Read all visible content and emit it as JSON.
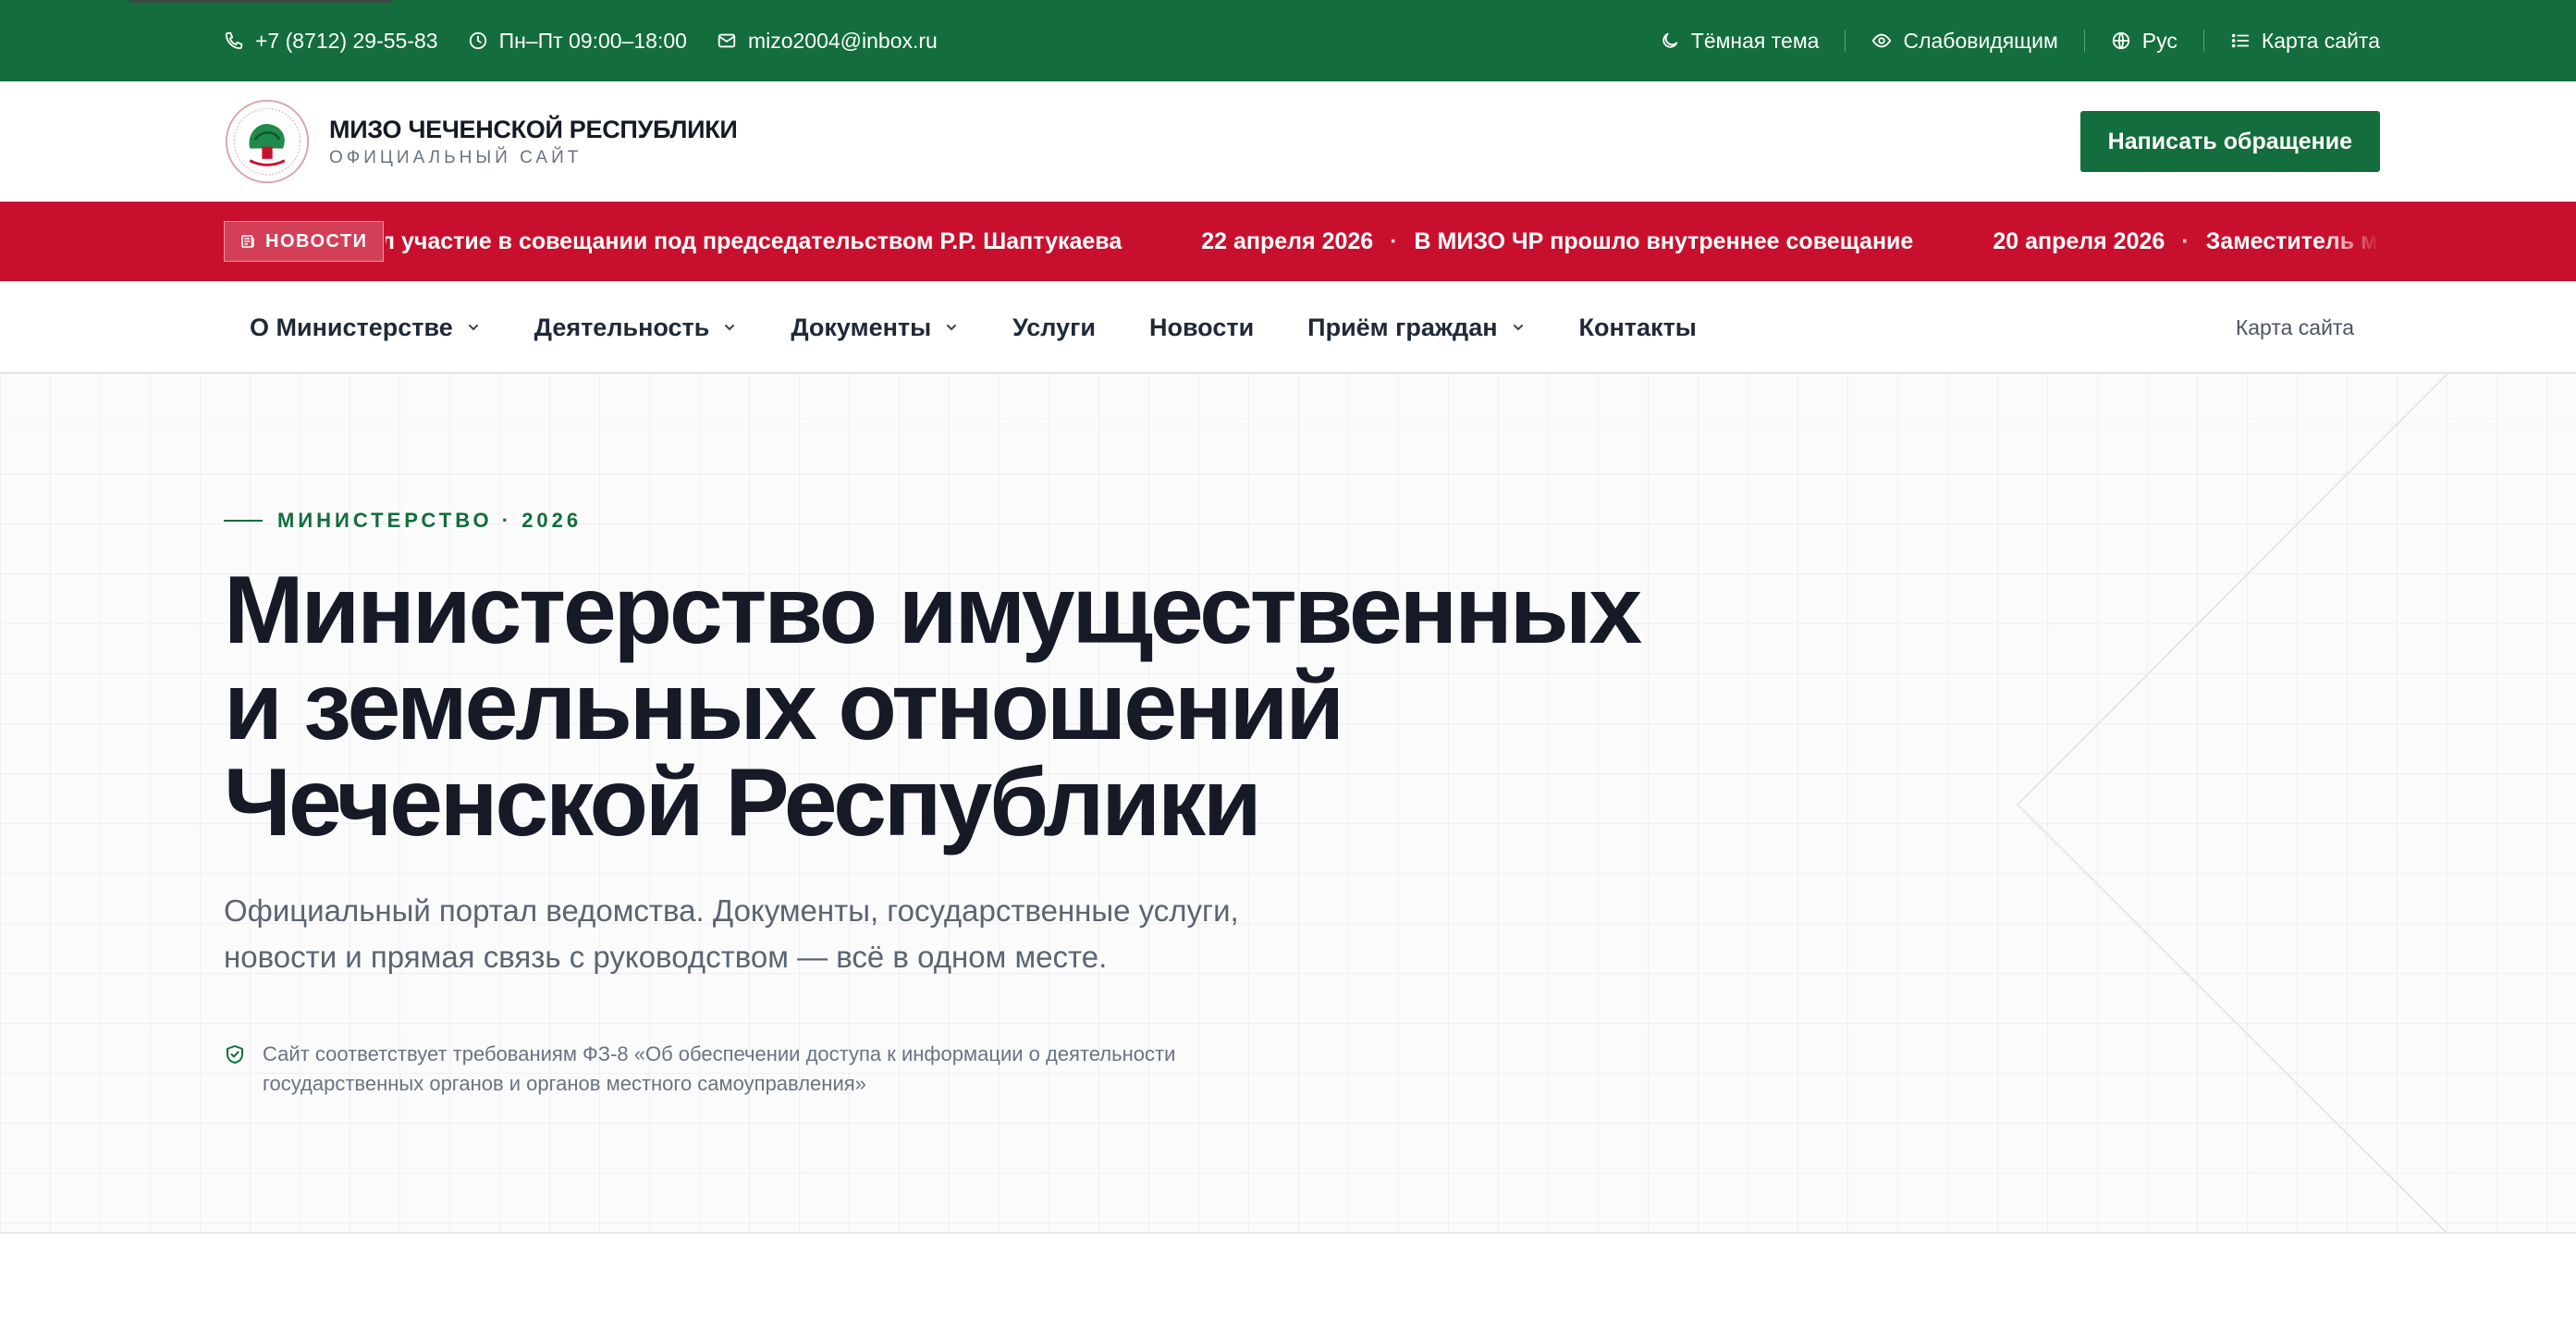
{
  "topbar": {
    "phone": "+7 (8712) 29-55-83",
    "hours": "Пн–Пт 09:00–18:00",
    "email": "mizo2004@inbox.ru",
    "dark_theme": "Тёмная тема",
    "low_vision": "Слабовидящим",
    "language": "Рус",
    "sitemap": "Карта сайта"
  },
  "header": {
    "title": "МИЗО ЧЕЧЕНСКОЙ РЕСПУБЛИКИ",
    "subtitle": "ОФИЦИАЛЬНЫЙ САЙТ",
    "cta": "Написать обращение"
  },
  "ticker": {
    "badge": "НОВОСТИ",
    "partial_text": "ял участие в совещании под председательством Р.Р. Шаптукаева",
    "items": [
      {
        "date": "22 апреля 2026",
        "text": "В МИЗО ЧР прошло внутреннее совещание"
      },
      {
        "date": "20 апреля 2026",
        "text": "Заместитель министра"
      }
    ]
  },
  "nav": {
    "items": [
      {
        "label": "О Министерстве",
        "dropdown": true
      },
      {
        "label": "Деятельность",
        "dropdown": true
      },
      {
        "label": "Документы",
        "dropdown": true
      },
      {
        "label": "Услуги",
        "dropdown": false
      },
      {
        "label": "Новости",
        "dropdown": false
      },
      {
        "label": "Приём граждан",
        "dropdown": true
      },
      {
        "label": "Контакты",
        "dropdown": false
      }
    ],
    "sitemap": "Карта сайта"
  },
  "hero": {
    "eyebrow": "МИНИСТЕРСТВО · 2026",
    "title_lines": [
      "Министерство имущественных",
      "и земельных отношений",
      "Чеченской Республики"
    ],
    "subtitle_lines": [
      "Официальный портал ведомства. Документы, государственные услуги,",
      "новости и прямая связь с руководством — всё в одном месте."
    ],
    "note_lines": [
      "Сайт соответствует требованиям ФЗ-8 «Об обеспечении доступа к информации о деятельности",
      "государственных органов и органов местного самоуправления»"
    ]
  },
  "colors": {
    "brand_green": "#136d3c",
    "ticker_red": "#c8102e",
    "title_dark": "#161a26"
  },
  "icons": {
    "phone": "phone-icon",
    "hours": "clock-icon",
    "email": "mail-icon",
    "dark_theme": "moon-icon",
    "low_vision": "eye-icon",
    "language": "globe-icon",
    "sitemap": "list-icon",
    "news": "newspaper-icon",
    "compliance": "shield-check-icon"
  }
}
